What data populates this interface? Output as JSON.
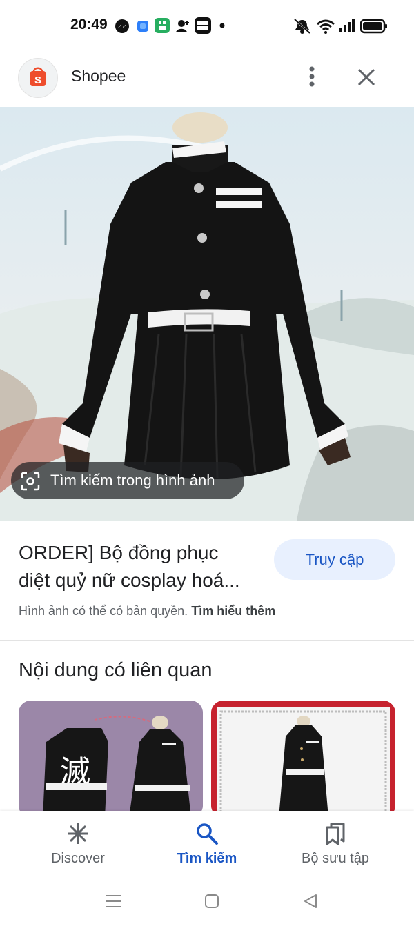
{
  "status_bar": {
    "time": "20:49"
  },
  "header": {
    "app_name": "Shopee",
    "app_icon": "shopee-bag-icon",
    "more_icon": "more-vert-icon",
    "close_icon": "close-icon"
  },
  "hero": {
    "lens_label": "Tìm kiếm trong hình ảnh"
  },
  "product": {
    "title_line1": "ORDER] Bộ đồng phục",
    "title_line2": "diệt quỷ nữ cosplay hoá...",
    "visit_label": "Truy cập",
    "copyright_text": "Hình ảnh có thể có bản quyền.",
    "learn_more": "Tìm hiểu thêm"
  },
  "related": {
    "heading": "Nội dung có liên quan",
    "card1_glyph": "滅"
  },
  "bottom_nav": {
    "items": [
      {
        "label": "Discover",
        "icon": "asterisk-icon",
        "active": false
      },
      {
        "label": "Tìm kiếm",
        "icon": "search-icon",
        "active": true
      },
      {
        "label": "Bộ sưu tập",
        "icon": "collections-icon",
        "active": false
      }
    ]
  },
  "colors": {
    "accent": "#1a56c4",
    "visit_bg": "#e8f0fe",
    "shopee": "#ee4d2d"
  }
}
